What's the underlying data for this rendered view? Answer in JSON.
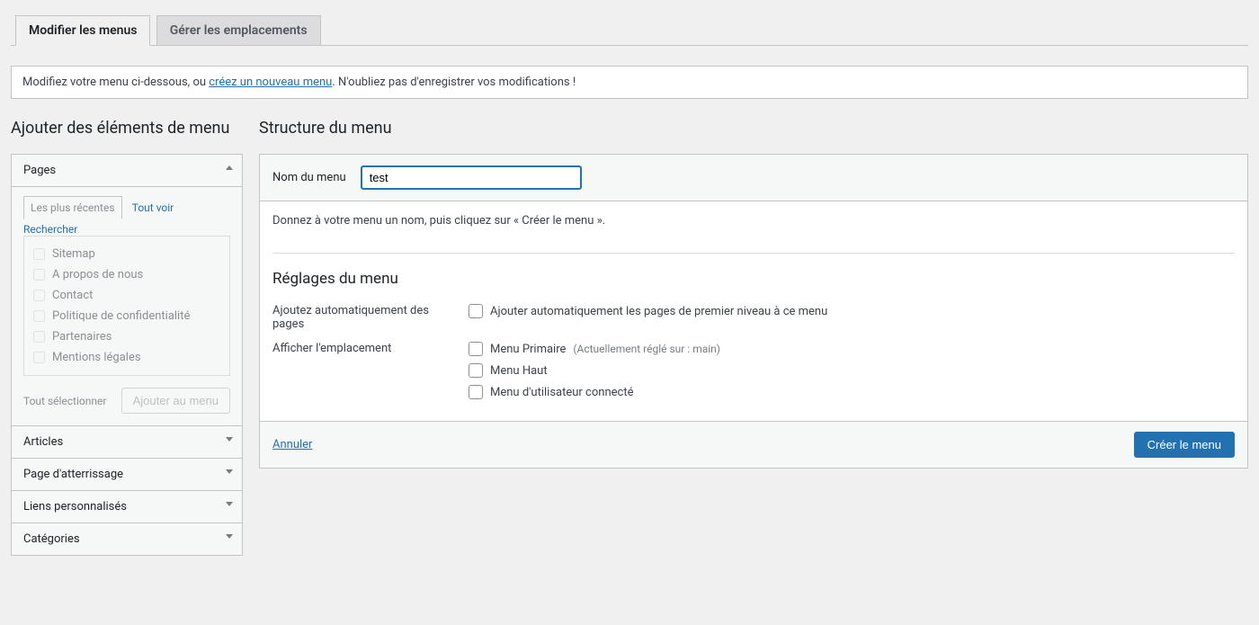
{
  "tabs": {
    "modify": "Modifier les menus",
    "locations": "Gérer les emplacements"
  },
  "notice": {
    "prefix": "Modifiez votre menu ci-dessous, ou ",
    "link": "créez un nouveau menu",
    "suffix": ". N'oubliez pas d'enregistrer vos modifications !"
  },
  "left": {
    "title": "Ajouter des éléments de menu",
    "pages": {
      "heading": "Pages",
      "subtabs": {
        "recent": "Les plus récentes",
        "view_all": "Tout voir",
        "search": "Rechercher"
      },
      "items": [
        "Sitemap",
        "A propos de nous",
        "Contact",
        "Politique de confidentialité",
        "Partenaires",
        "Mentions légales"
      ],
      "select_all": "Tout sélectionner",
      "add_button": "Ajouter au menu"
    },
    "groups": {
      "articles": "Articles",
      "landing": "Page d'atterrissage",
      "custom_links": "Liens personnalisés",
      "categories": "Catégories"
    }
  },
  "right": {
    "title": "Structure du menu",
    "name_label": "Nom du menu",
    "name_value": "test",
    "help": "Donnez à votre menu un nom, puis cliquez sur « Créer le menu ».",
    "settings_title": "Réglages du menu",
    "auto_add_label": "Ajoutez automatiquement des pages",
    "auto_add_option": "Ajouter automatiquement les pages de premier niveau à ce menu",
    "display_location_label": "Afficher l'emplacement",
    "locations": {
      "primary": "Menu Primaire",
      "primary_hint": "(Actuellement réglé sur : main)",
      "top": "Menu Haut",
      "logged": "Menu d'utilisateur connecté"
    },
    "cancel": "Annuler",
    "create": "Créer le menu"
  }
}
